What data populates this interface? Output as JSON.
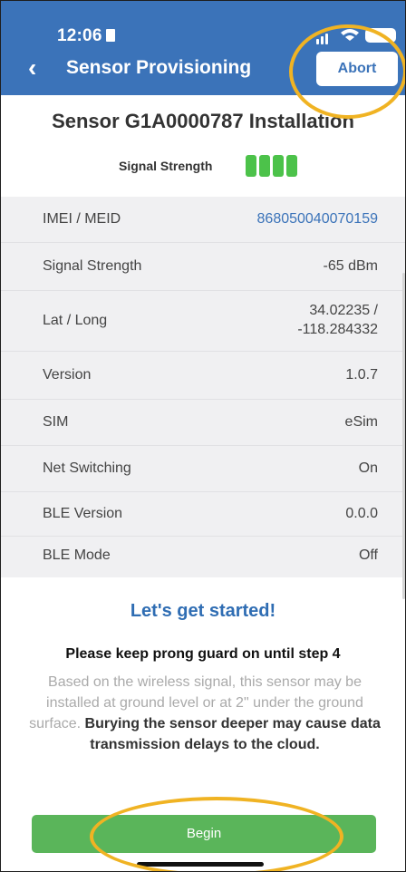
{
  "status_bar": {
    "time": "12:06"
  },
  "header": {
    "back_glyph": "‹",
    "title": "Sensor Provisioning",
    "abort_label": "Abort"
  },
  "install": {
    "title": "Sensor G1A0000787 Installation",
    "signal_label": "Signal Strength",
    "signal_level": 4,
    "signal_max": 4
  },
  "details": [
    {
      "label": "IMEI / MEID",
      "value": "868050040070159"
    },
    {
      "label": "Signal Strength",
      "value": "-65 dBm"
    },
    {
      "label": "Lat / Long",
      "value_line1": "34.02235 /",
      "value_line2": "-118.284332"
    },
    {
      "label": "Version",
      "value": "1.0.7"
    },
    {
      "label": "SIM",
      "value": "eSim"
    },
    {
      "label": "Net Switching",
      "value": "On"
    },
    {
      "label": "BLE Version",
      "value": "0.0.0"
    },
    {
      "label": "BLE Mode",
      "value": "Off"
    }
  ],
  "intro": {
    "heading": "Let's get started!",
    "subheading": "Please keep prong guard on until step 4",
    "desc_plain": "Based on the wireless signal, this sensor may be installed at ground level or at 2\" under the ground surface.",
    "desc_bold": "Burying the sensor deeper may cause data transmission delays to the cloud."
  },
  "begin_label": "Begin",
  "colors": {
    "primary": "#3b73b9",
    "success": "#5ab55a",
    "highlight": "#f0b323"
  }
}
